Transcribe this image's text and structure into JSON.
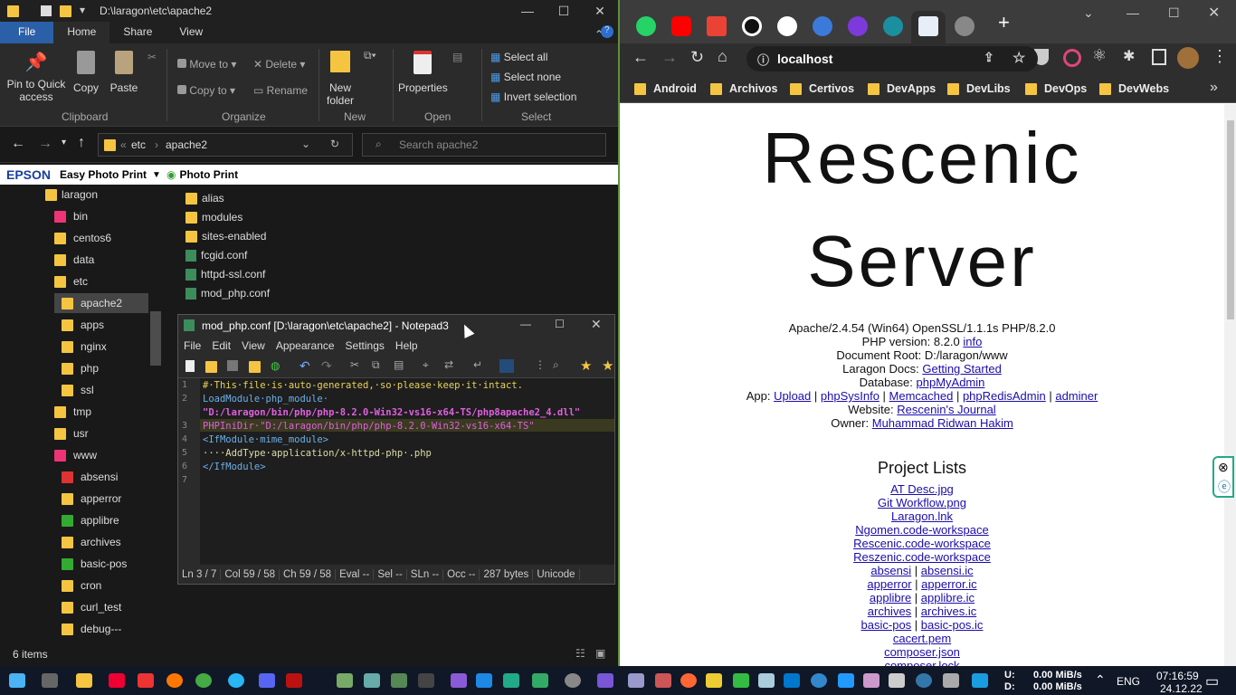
{
  "explorer": {
    "title": "D:\\laragon\\etc\\apache2",
    "tabs": [
      "File",
      "Home",
      "Share",
      "View"
    ],
    "ribbon": {
      "pin": "Pin to Quick access",
      "copy": "Copy",
      "paste": "Paste",
      "clipboard": "Clipboard",
      "move_to": "Move to",
      "copy_to": "Copy to",
      "delete": "Delete",
      "rename": "Rename",
      "organize": "Organize",
      "new_folder": "New folder",
      "new": "New",
      "properties": "Properties",
      "open": "Open",
      "select_all": "Select all",
      "select_none": "Select none",
      "invert_selection": "Invert selection",
      "select": "Select"
    },
    "breadcrumb": [
      "etc",
      "apache2"
    ],
    "search_placeholder": "Search apache2",
    "epson": {
      "brand": "EPSON",
      "easy": "Easy Photo Print",
      "photo": "Photo Print"
    },
    "tree": [
      "laragon",
      "bin",
      "centos6",
      "data",
      "etc",
      "apache2",
      "apps",
      "nginx",
      "php",
      "ssl",
      "tmp",
      "usr",
      "www",
      "absensi",
      "apperror",
      "applibre",
      "archives",
      "basic-pos",
      "cron",
      "curl_test",
      "debug---"
    ],
    "files": [
      "alias",
      "modules",
      "sites-enabled",
      "fcgid.conf",
      "httpd-ssl.conf",
      "mod_php.conf"
    ],
    "status": "6 items"
  },
  "notepad": {
    "title": "mod_php.conf [D:\\laragon\\etc\\apache2] - Notepad3",
    "menu": [
      "File",
      "Edit",
      "View",
      "Appearance",
      "Settings",
      "Help"
    ],
    "lines": [
      {
        "n": "1",
        "text": "#·This·file·is·auto-generated,·so·please·keep·it·intact."
      },
      {
        "n": "2",
        "text": "LoadModule·php_module·"
      },
      {
        "n": "",
        "text": "\"D:/laragon/bin/php/php-8.2.0-Win32-vs16-x64-TS/php8apache2_4.dll\""
      },
      {
        "n": "3",
        "text": "PHPIniDir·\"D:/laragon/bin/php/php-8.2.0-Win32-vs16-x64-TS\""
      },
      {
        "n": "4",
        "text": "<IfModule·mime_module>"
      },
      {
        "n": "5",
        "text": "····AddType·application/x-httpd-php·.php"
      },
      {
        "n": "6",
        "text": "</IfModule>"
      },
      {
        "n": "7",
        "text": ""
      }
    ],
    "status": [
      "Ln 3 / 7",
      "Col 59 / 58",
      "Ch 59 / 58",
      "Eval --",
      "Sel --",
      "SLn --",
      "Occ --",
      "287 bytes",
      "Unicode"
    ]
  },
  "chrome": {
    "url": "localhost",
    "bookmarks": [
      "Android",
      "Archivos",
      "Certivos",
      "DevApps",
      "DevLibs",
      "DevOps",
      "DevWebs"
    ],
    "page": {
      "title1": "Rescenic",
      "title2": "Server",
      "server": "Apache/2.4.54 (Win64) OpenSSL/1.1.1s PHP/8.2.0",
      "php_label": "PHP version: 8.2.0",
      "php_link": "info",
      "docroot": "Document Root: D:/laragon/www",
      "docs_label": "Laragon Docs:",
      "docs_link": "Getting Started",
      "db_label": "Database:",
      "db_link": "phpMyAdmin",
      "app_label": "App:",
      "apps": [
        "Upload",
        "phpSysInfo",
        "Memcached",
        "phpRedisAdmin",
        "adminer"
      ],
      "website_label": "Website:",
      "website_link": "Rescenin's Journal",
      "owner_label": "Owner:",
      "owner_link": "Muhammad Ridwan Hakim",
      "projects_title": "Project Lists",
      "projects": [
        "AT Desc.jpg",
        "Git Workflow.png",
        "Laragon.lnk",
        "Ngomen.code-workspace",
        "Rescenic.code-workspace",
        "Reszenic.code-workspace"
      ],
      "pairs": [
        [
          "absensi",
          "absensi.ic"
        ],
        [
          "apperror",
          "apperror.ic"
        ],
        [
          "applibre",
          "applibre.ic"
        ],
        [
          "archives",
          "archives.ic"
        ],
        [
          "basic-pos",
          "basic-pos.ic"
        ]
      ],
      "more": [
        "cacert.pem",
        "composer.json",
        "composer.lock"
      ]
    }
  },
  "taskbar": {
    "upload": "0.00 MiB/s",
    "download": "0.00 MiB/s",
    "u": "U:",
    "d": "D:",
    "lang": "ENG",
    "time": "07:16:59",
    "date": "24.12.22"
  }
}
